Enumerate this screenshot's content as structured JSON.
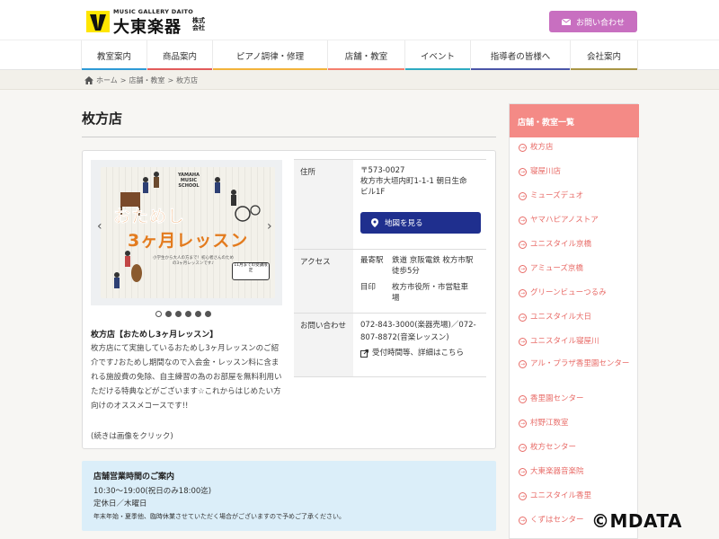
{
  "header": {
    "logo_top": "MUSIC GALLERY DAITO",
    "logo_main": "大東楽器",
    "logo_sub": "株式会社",
    "contact_label": "お問い合わせ"
  },
  "nav": {
    "items": [
      {
        "label": "教室案内",
        "color": "#2e9ad6"
      },
      {
        "label": "商品案内",
        "color": "#e25b5b"
      },
      {
        "label": "ピアノ調律・修理",
        "color": "#f2b33a"
      },
      {
        "label": "店舗・教室",
        "color": "#f47f6e"
      },
      {
        "label": "イベント",
        "color": "#2eaac1"
      },
      {
        "label": "指導者の皆様へ",
        "color": "#4a55a8"
      },
      {
        "label": "会社案内",
        "color": "#a99545"
      }
    ]
  },
  "breadcrumb": {
    "home": "ホーム",
    "sep": ">",
    "parent": "店舗・教室",
    "current": "枚方店"
  },
  "page": {
    "title": "枚方店"
  },
  "slide": {
    "school": "YAMAHA MUSIC SCHOOL",
    "line1": "おためし",
    "line2": "3ヶ月レッスン",
    "small": "小学生から大人の方まで！初心者さんのための3ヶ月レッスンです♪",
    "badge": "11月までの受講限定"
  },
  "description": {
    "title": "枚方店【おためし3ヶ月レッスン】",
    "body": "枚方店にて実施しているおためし3ヶ月レッスンのご紹介です♪おためし期間なので入会金・レッスン料に含まれる施設費の免除、自主練習の為のお部屋を無料利用いただける特典などがございます☆これからはじめたい方向けのオススメコースです!!",
    "more": "(続きは画像をクリック)"
  },
  "info": {
    "address_label": "住所",
    "address_zip": "〒573-0027",
    "address_line1": "枚方市大垣内町1-1-1 朝日生命",
    "address_line2": "ビル1F",
    "map_button": "地図を見る",
    "access_label": "アクセス",
    "access_station_label": "最寄駅",
    "access_station_1": "鉄道 京阪電鉄 枚方市駅",
    "access_station_2": "徒歩5分",
    "access_landmark_label": "目印",
    "access_landmark_1": "枚方市役所・市営駐車",
    "access_landmark_2": "場",
    "contact_label": "お問い合わせ",
    "contact_phone_1": "072-843-3000(楽器売場)／072-",
    "contact_phone_2": "807-8872(音楽レッスン)",
    "contact_link": "受付時間等、詳細はこちら"
  },
  "hours": {
    "title": "店舗営業時間のご案内",
    "time": "10:30〜19:00(祝日のみ18:00迄)",
    "closed": "定休日／木曜日",
    "note": "年末年始・夏季他、臨時休業させていただく場合がございますので予めご了承ください。"
  },
  "sidebar": {
    "title": "店舗・教室一覧",
    "items": [
      "枚方店",
      "寝屋川店",
      "ミューズデュオ",
      "ヤマハピアノストア",
      "ユニスタイル京橋",
      "アミューズ京橋",
      "グリーンビューつるみ",
      "ユニスタイル大日",
      "ユニスタイル寝屋川",
      "アル・プラザ香里園センター",
      "香里園センター",
      "村野江数室",
      "枚方センター",
      "大東楽器音楽院",
      "ユニスタイル香里",
      "くずはセンター"
    ]
  },
  "watermark": "©MDATA"
}
